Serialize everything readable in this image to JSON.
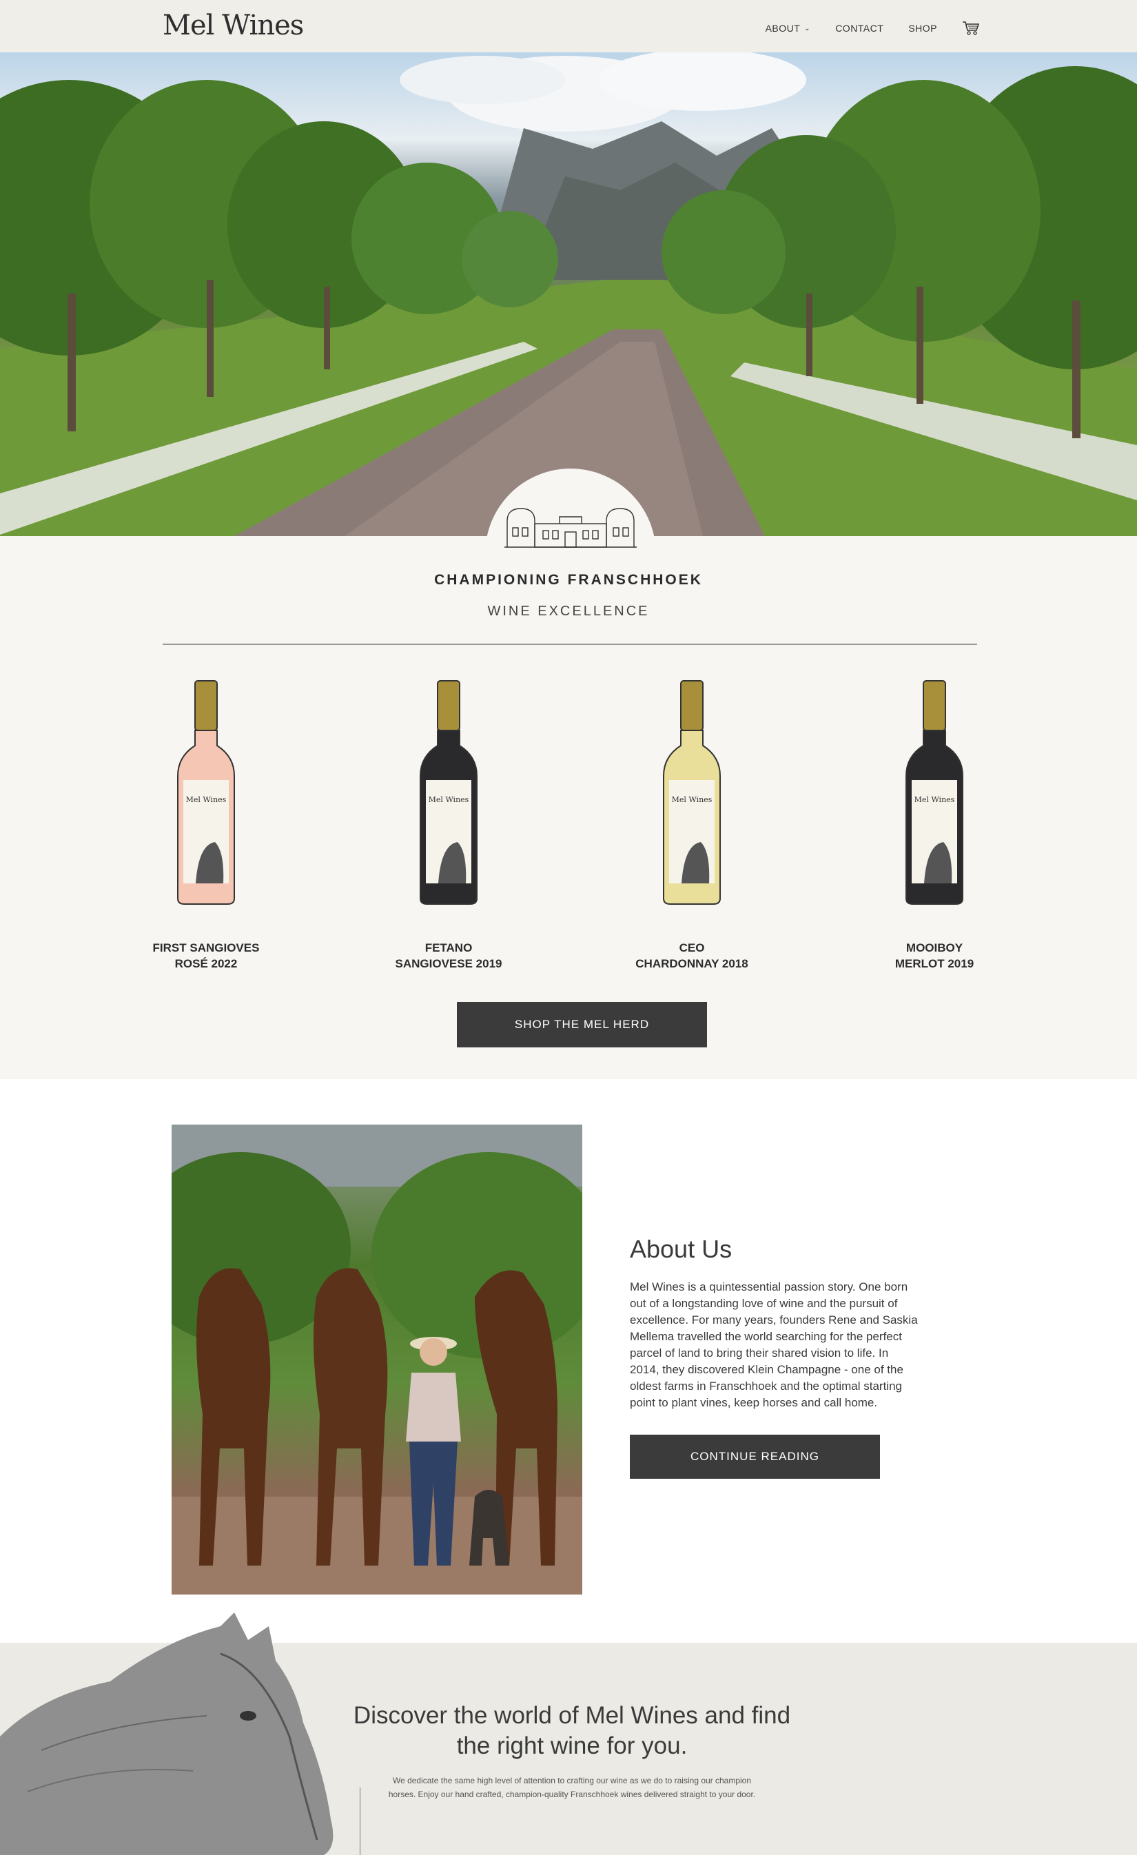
{
  "header": {
    "logo": "Mel Wines",
    "nav": [
      {
        "label": "ABOUT"
      },
      {
        "label": "CONTACT"
      },
      {
        "label": "SHOP"
      }
    ],
    "cart_icon": "cart-icon"
  },
  "intro": {
    "title": "CHAMPIONING FRANSCHHOEK",
    "subtitle": "WINE EXCELLENCE"
  },
  "products": [
    {
      "line1": "FIRST SANGIOVES",
      "line2": "ROSÉ 2022",
      "bottle_color": "#f6c6b4",
      "label_text": "Mel Wines"
    },
    {
      "line1": "FETANO",
      "line2": "SANGIOVESE 2019",
      "bottle_color": "#2a2a2c",
      "label_text": "Mel Wines"
    },
    {
      "line1": "CEO",
      "line2": "CHARDONNAY 2018",
      "bottle_color": "#e9df9a",
      "label_text": "Mel Wines"
    },
    {
      "line1": "MOOIBOY",
      "line2": "MERLOT 2019",
      "bottle_color": "#2a2a2c",
      "label_text": "Mel Wines"
    }
  ],
  "shop_button": "SHOP THE MEL HERD",
  "about": {
    "title": "About Us",
    "body": "Mel Wines is a quintessential passion story. One born out of a longstanding love of wine and the pursuit of excellence. For many years, founders Rene and Saskia Mellema travelled the world searching for the perfect parcel of land to bring their shared vision to life. In 2014, they discovered Klein Champagne - one of the oldest farms in Franschhoek and the optimal starting point to plant vines, keep horses and call home.",
    "button": "CONTINUE READING"
  },
  "discover": {
    "title": "Discover the world of Mel Wines and find the right wine for you.",
    "body": "We dedicate the same high level of attention to crafting our wine as we do to raising our champion horses. Enjoy our hand crafted, champion-quality Franschhoek wines delivered straight to your door."
  },
  "colors": {
    "header_bg": "#efeee8",
    "button_bg": "#3b3b3b",
    "section_bg": "#f7f6f2",
    "capsule": "#a8903a"
  }
}
